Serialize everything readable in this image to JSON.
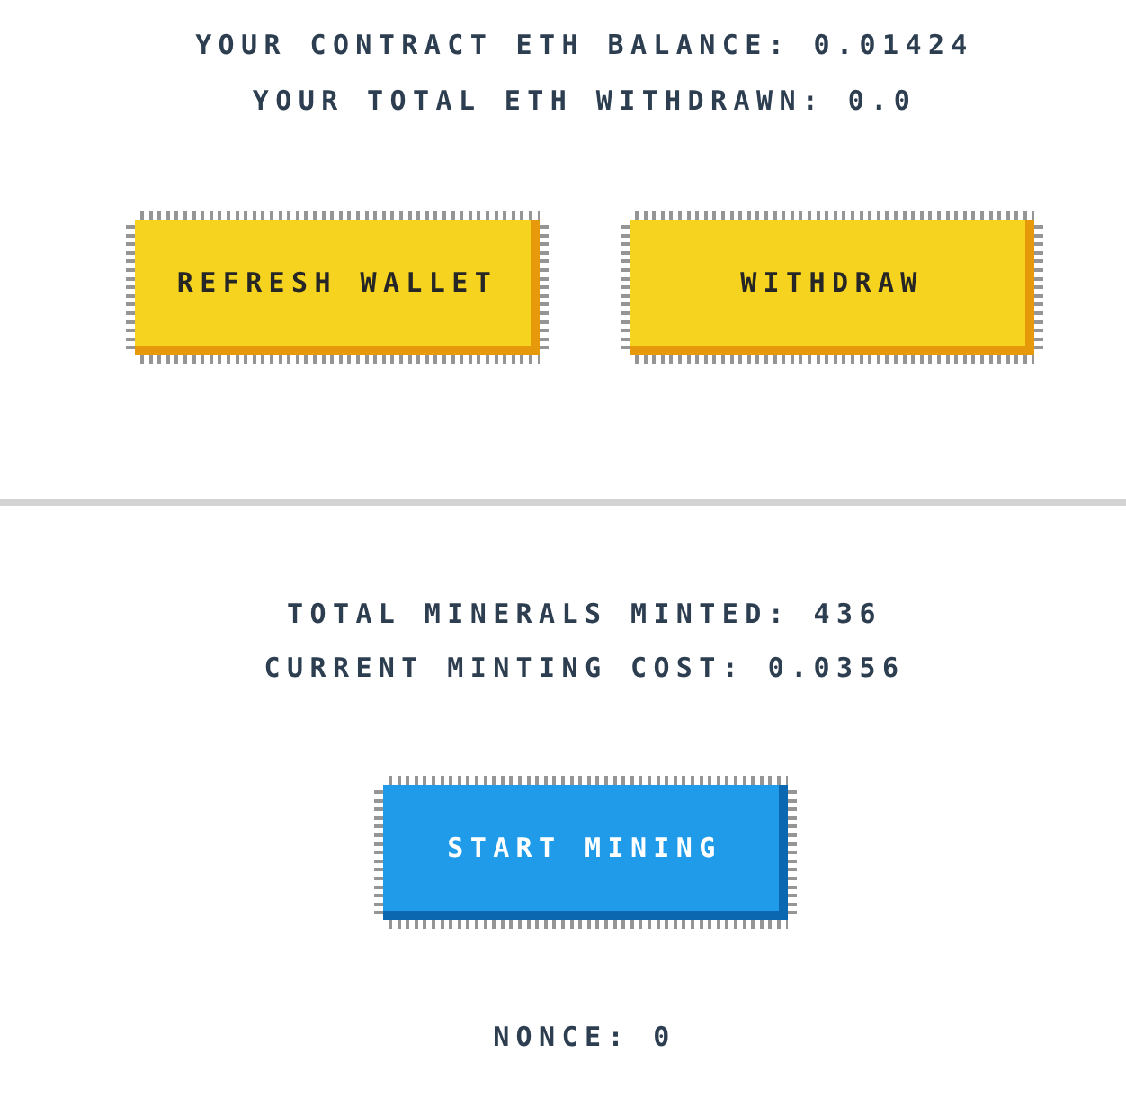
{
  "account": {
    "stats": [
      "YOUR CONTRACT ETH BALANCE: 0.01424",
      "YOUR TOTAL ETH WITHDRAWN: 0.0"
    ],
    "buttons": [
      "REFRESH WALLET",
      "WITHDRAW"
    ]
  },
  "mining": {
    "stats": [
      "TOTAL MINERALS MINTED: 436",
      "CURRENT MINTING COST: 0.0356"
    ],
    "button": "START MINING",
    "nonce": "NONCE: 0"
  }
}
